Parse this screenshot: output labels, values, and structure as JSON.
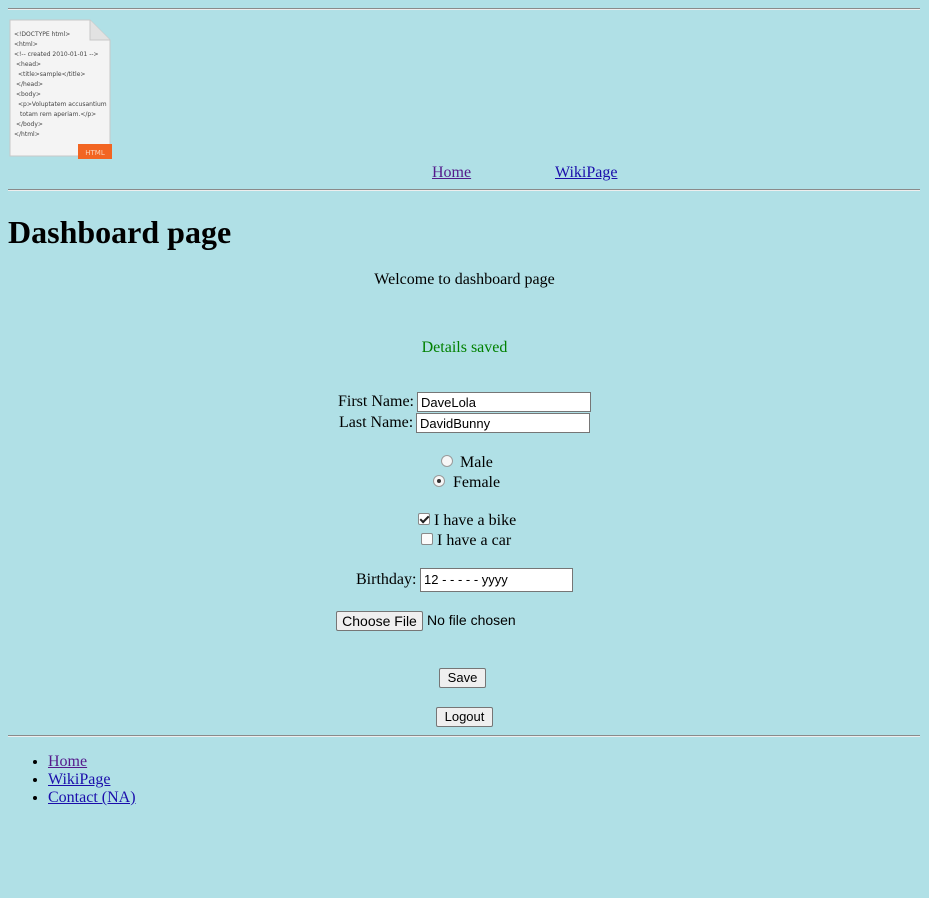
{
  "logo": {
    "icon": "html-file-icon",
    "badge_text": "HTML"
  },
  "nav": {
    "home": "Home",
    "wiki": "WikiPage"
  },
  "page": {
    "title": "Dashboard page",
    "welcome": "Welcome to dashboard page",
    "status": "Details saved"
  },
  "form": {
    "first_name_label": "First Name:",
    "first_name_value": "DaveLola",
    "last_name_label": "Last Name:",
    "last_name_value": "DavidBunny",
    "gender_options": [
      "Male",
      "Female"
    ],
    "gender_selected": "Female",
    "vehicle_options": [
      {
        "label": "I have a bike",
        "checked": true
      },
      {
        "label": "I have a car",
        "checked": false
      }
    ],
    "birthday_label": "Birthday:",
    "birthday_value": "12 - - - - - yyyy",
    "file_button": "Choose File",
    "file_status": "No file chosen",
    "save_label": "Save",
    "logout_label": "Logout"
  },
  "footer": {
    "links": [
      "Home",
      "WikiPage",
      "Contact (NA)"
    ]
  },
  "colors": {
    "background": "#b0e0e6",
    "status_green": "#008000",
    "link": "#1a0dab",
    "visited": "#551a8b"
  }
}
